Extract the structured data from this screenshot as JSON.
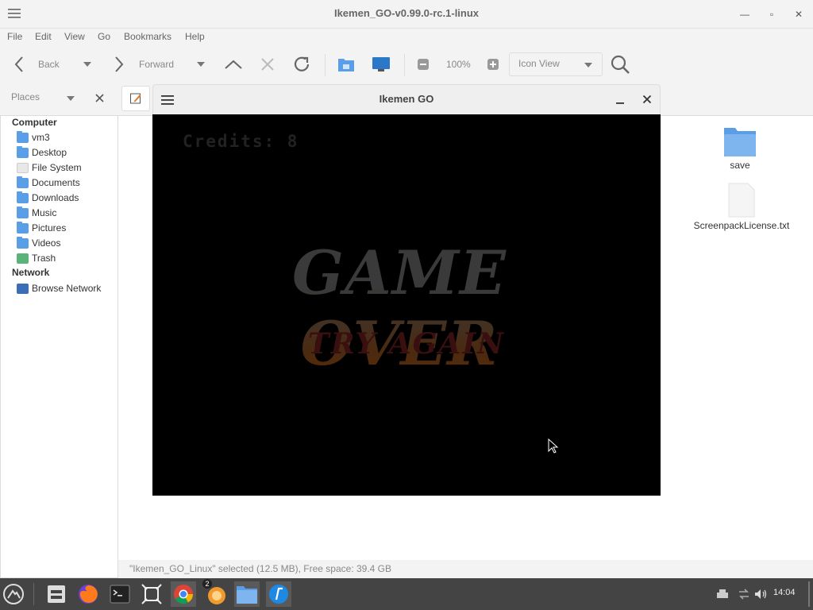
{
  "file_manager": {
    "title": "Ikemen_GO-v0.99.0-rc.1-linux",
    "menu": [
      "File",
      "Edit",
      "View",
      "Go",
      "Bookmarks",
      "Help"
    ],
    "toolbar": {
      "back_label": "Back",
      "forward_label": "Forward",
      "zoom_level": "100%",
      "view_mode": "Icon View"
    },
    "places_label": "Places",
    "sidebar": {
      "computer_header": "Computer",
      "computer_items": [
        "vm3",
        "Desktop",
        "File System",
        "Documents",
        "Downloads",
        "Music",
        "Pictures",
        "Videos",
        "Trash"
      ],
      "network_header": "Network",
      "network_items": [
        "Browse Network"
      ]
    },
    "files": [
      {
        "name": "save",
        "icon": "folder-icon"
      },
      {
        "name": "ScreenpackLicense.txt",
        "icon": "text-file-icon"
      }
    ],
    "status_text": "\"Ikemen_GO_Linux\" selected (12.5 MB), Free space: 39.4 GB"
  },
  "game_window": {
    "title": "Ikemen GO",
    "credits_text": "Credits: 8",
    "game_over_text": "GAME OVER",
    "try_again_text": "TRY AGAIN"
  },
  "taskbar": {
    "badge_count": "2",
    "clock": "14:04"
  },
  "colors": {
    "taskbar_bg": "#444444",
    "folder_blue": "#5b9ee8",
    "game_bg": "#000000"
  }
}
